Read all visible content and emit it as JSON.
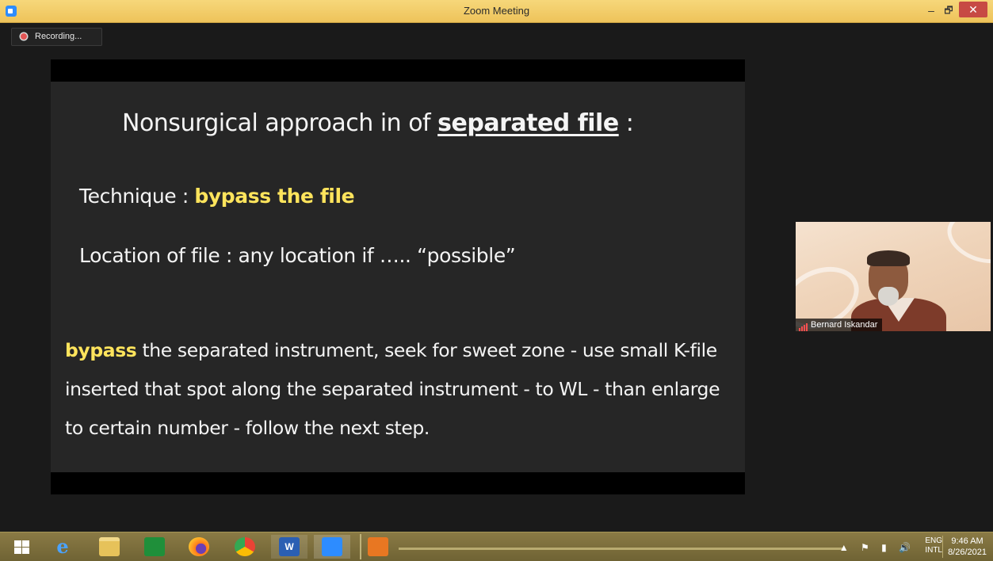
{
  "window": {
    "title": "Zoom Meeting",
    "min": "–",
    "max": "🗗",
    "close": "✕"
  },
  "recording": {
    "label": "Recording..."
  },
  "slide": {
    "title_prefix": "Nonsurgical approach in of ",
    "title_highlight": "separated file",
    "title_suffix": " :",
    "technique_label": "Technique : ",
    "technique_value": "bypass the file",
    "location_text": "Location of file : any location if  ….. “possible”",
    "para_highlight": "bypass",
    "para_line1_rest": " the separated instrument,  seek for sweet zone - use small K-file",
    "para_line2": "inserted that spot along the separated instrument - to WL - than enlarge",
    "para_line3": "to certain number - follow the next step.",
    "highlight_color": "#ffe45c"
  },
  "participant": {
    "name": "Bernard Iskandar"
  },
  "taskbar": {
    "apps": [
      "start",
      "internet-explorer",
      "file-explorer",
      "store",
      "firefox",
      "chrome",
      "word",
      "zoom",
      "media-player"
    ],
    "tray_icons": "▲ ⚑ ▮ 🔊",
    "lang_top": "ENG",
    "lang_bottom": "INTL",
    "time": "9:46 AM",
    "date": "8/26/2021"
  }
}
